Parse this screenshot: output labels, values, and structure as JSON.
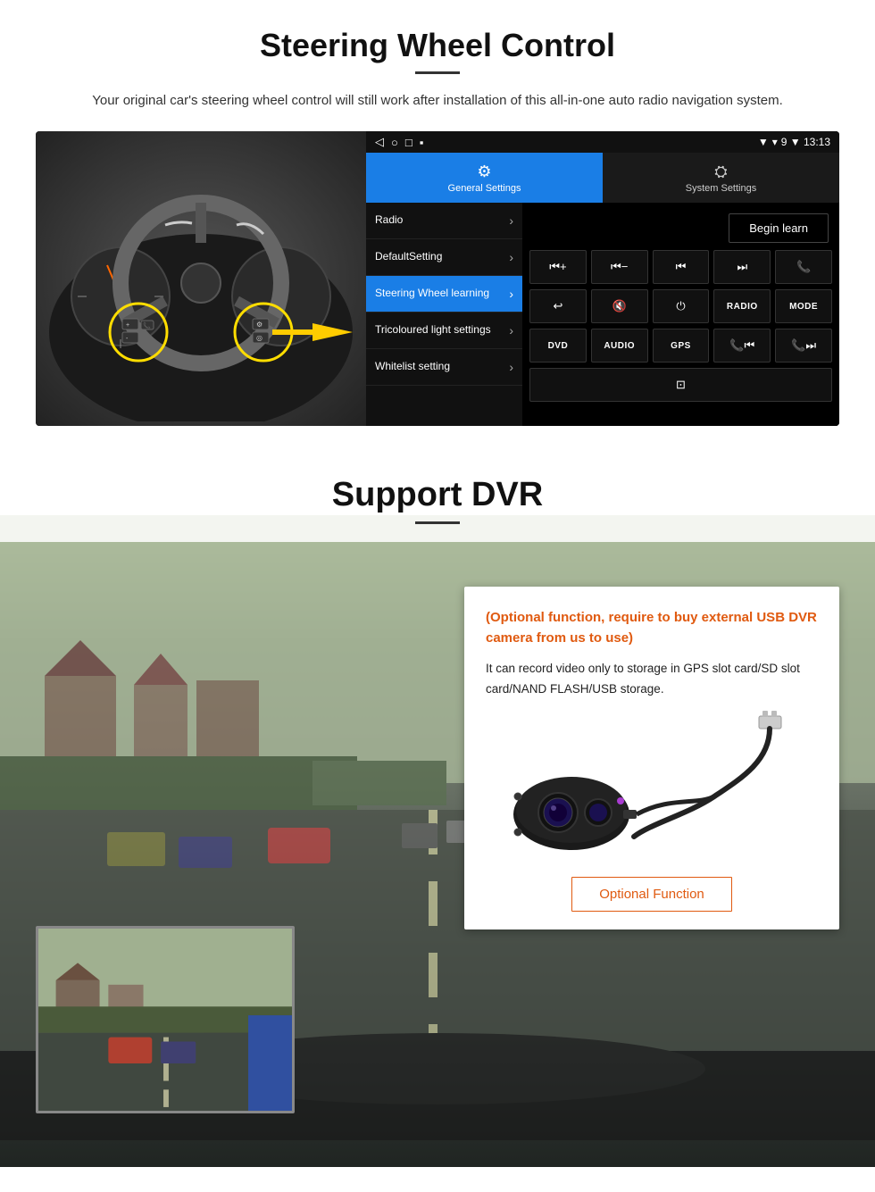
{
  "page": {
    "steering": {
      "title": "Steering Wheel Control",
      "description": "Your original car's steering wheel control will still work after installation of this all-in-one auto radio navigation system.",
      "statusbar": {
        "left_icons": [
          "◁",
          "○",
          "□",
          "▪"
        ],
        "right": "9 ▼ 13:13"
      },
      "tabs": [
        {
          "icon": "⚙",
          "label": "General Settings",
          "active": true
        },
        {
          "icon": "⛭",
          "label": "System Settings",
          "active": false
        }
      ],
      "menu": [
        {
          "label": "Radio",
          "active": false
        },
        {
          "label": "DefaultSetting",
          "active": false
        },
        {
          "label": "Steering Wheel learning",
          "active": true
        },
        {
          "label": "Tricoloured light settings",
          "active": false
        },
        {
          "label": "Whitelist setting",
          "active": false
        }
      ],
      "begin_learn": "Begin learn",
      "control_buttons_row1": [
        "⏮+",
        "⏮-",
        "⏮",
        "⏭",
        "📞"
      ],
      "control_buttons_row2": [
        "↩",
        "🔇",
        "⏻",
        "RADIO",
        "MODE"
      ],
      "control_buttons_row3": [
        "DVD",
        "AUDIO",
        "GPS",
        "📞⏮",
        "📞⏭"
      ],
      "control_buttons_row4": [
        "⊡"
      ]
    },
    "dvr": {
      "title": "Support DVR",
      "optional_text": "(Optional function, require to buy external USB DVR camera from us to use)",
      "description": "It can record video only to storage in GPS slot card/SD slot card/NAND FLASH/USB storage.",
      "optional_function_btn": "Optional Function"
    }
  }
}
